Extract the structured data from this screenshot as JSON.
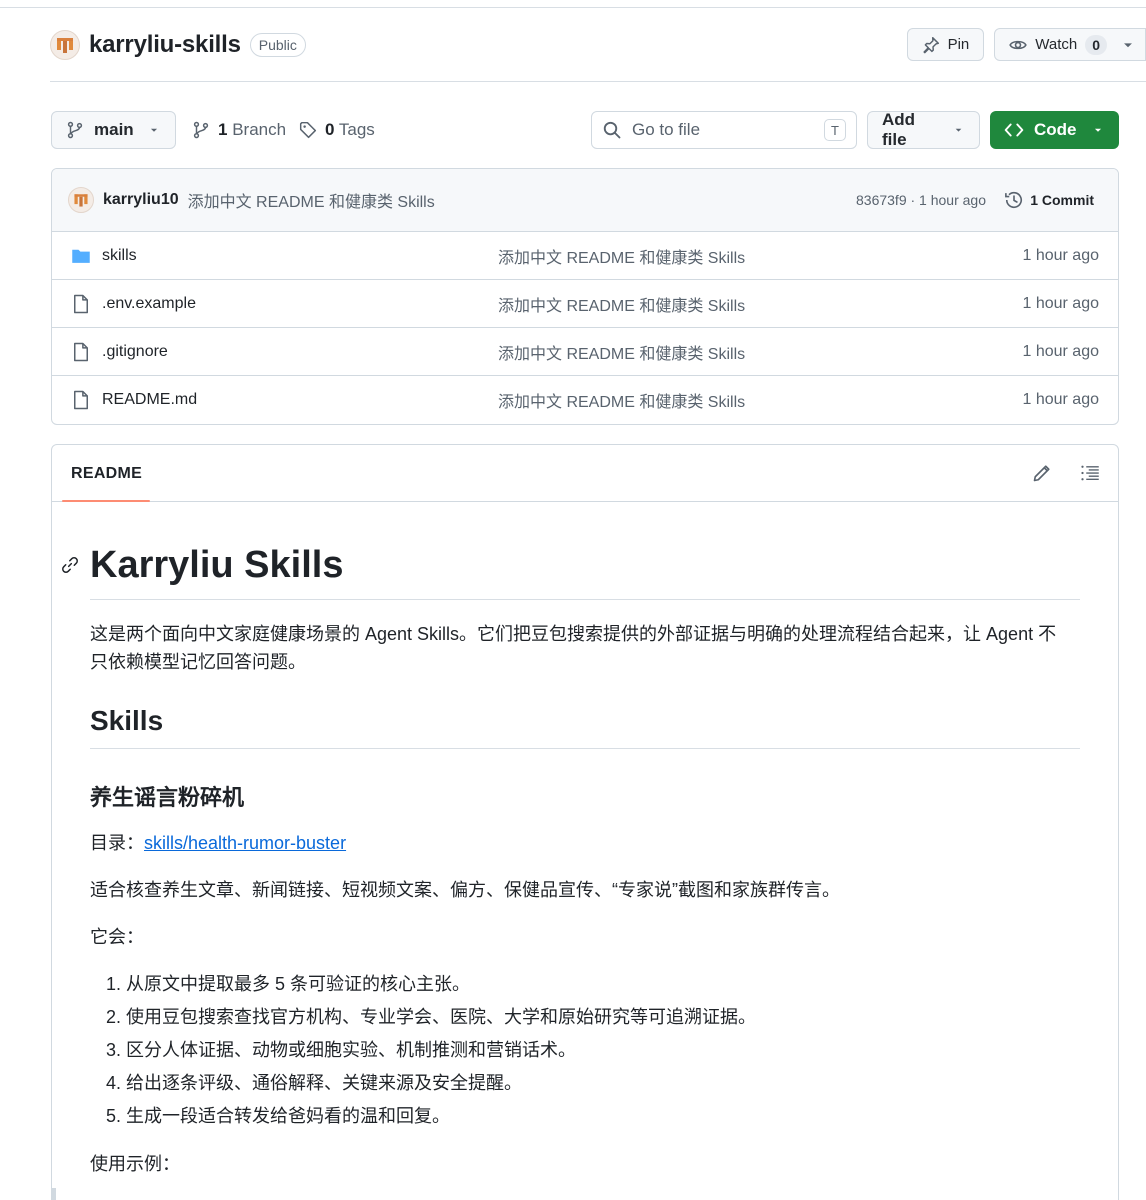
{
  "repo": {
    "name": "karryliu-skills",
    "visibility": "Public",
    "pin_label": "Pin",
    "watch_label": "Watch",
    "watch_count": "0"
  },
  "toolbar": {
    "branch": "main",
    "branches_count": "1",
    "branches_label": "Branch",
    "tags_count": "0",
    "tags_label": "Tags",
    "search_placeholder": "Go to file",
    "search_shortcut": "T",
    "add_file_label": "Add file",
    "code_label": "Code"
  },
  "latest_commit": {
    "author": "karryliu10",
    "message": "添加中文 README 和健康类 Skills",
    "meta": "83673f9 · 1 hour ago",
    "commits_label": "1 Commit"
  },
  "files": [
    {
      "name": "skills",
      "type": "folder",
      "commit": "添加中文 README 和健康类 Skills",
      "age": "1 hour ago"
    },
    {
      "name": ".env.example",
      "type": "file",
      "commit": "添加中文 README 和健康类 Skills",
      "age": "1 hour ago"
    },
    {
      "name": ".gitignore",
      "type": "file",
      "commit": "添加中文 README 和健康类 Skills",
      "age": "1 hour ago"
    },
    {
      "name": "README.md",
      "type": "file",
      "commit": "添加中文 README 和健康类 Skills",
      "age": "1 hour ago"
    }
  ],
  "readme": {
    "tab_label": "README",
    "h1": "Karryliu Skills",
    "intro_line1": "这是两个面向中文家庭健康场景的 Agent Skills。它们把豆包搜索提供的外部证据与明确的处理流程结合起来，让 Agent 不",
    "intro_line2": "只依赖模型记忆回答问题。",
    "h2": "Skills",
    "h3": "养生谣言粉碎机",
    "dir_label": "目录：",
    "dir_link": "skills/health-rumor-buster",
    "suitable": "适合核查养生文章、新闻链接、短视频文案、偏方、保健品宣传、“专家说”截图和家族群传言。",
    "will_label": "它会：",
    "steps": [
      "1. 从原文中提取最多 5 条可验证的核心主张。",
      "2. 使用豆包搜索查找官方机构、专业学会、医院、大学和原始研究等可追溯证据。",
      "3. 区分人体证据、动物或细胞实验、机制推测和营销话术。",
      "4. 给出逐条评级、通俗解释、关键来源及安全提醒。",
      "5. 生成一段适合转发给爸妈看的温和回复。"
    ],
    "example_label": "使用示例："
  },
  "colors": {
    "accent_green": "#1f883d",
    "link_blue": "#0969da",
    "folder_blue": "#54aeff",
    "tab_underline": "#fd8c73"
  }
}
